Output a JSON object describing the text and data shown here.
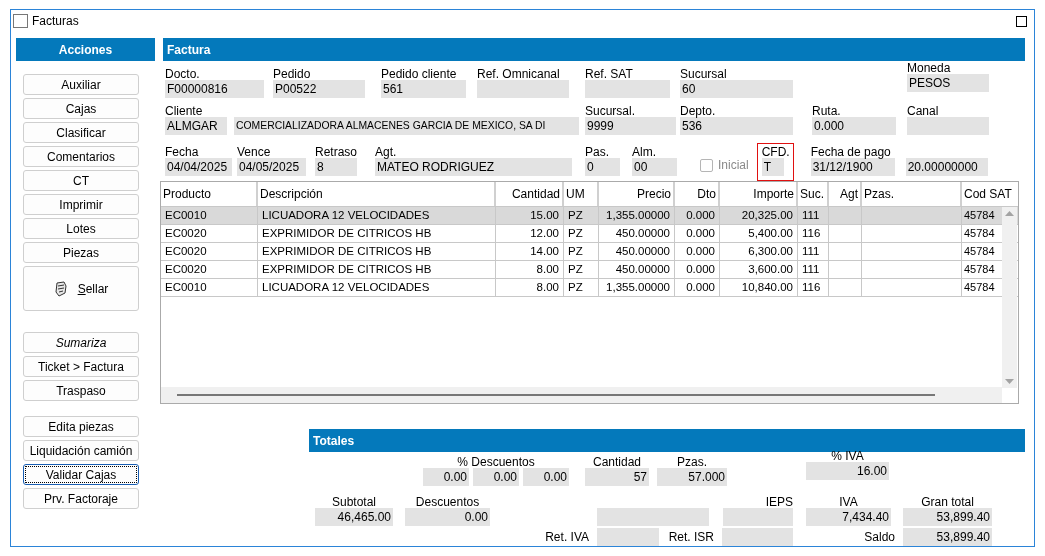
{
  "window": {
    "title": "Facturas"
  },
  "sidebar": {
    "title": "Acciones",
    "groups": [
      [
        {
          "label": "Auxiliar",
          "kind": "plain",
          "focused": false
        },
        {
          "label": "Cajas",
          "kind": "plain",
          "focused": false
        },
        {
          "label": "Clasificar",
          "kind": "plain",
          "focused": false
        },
        {
          "label": "Comentarios",
          "kind": "plain",
          "focused": false
        },
        {
          "label": "CT",
          "kind": "plain",
          "focused": false
        },
        {
          "label": "Imprimir",
          "kind": "plain",
          "focused": false
        },
        {
          "label": "Lotes",
          "kind": "plain",
          "focused": false
        },
        {
          "label": "Piezas",
          "kind": "plain",
          "focused": false
        },
        {
          "label": "Sellar",
          "kind": "icon",
          "mnemonic": true,
          "focused": false
        }
      ],
      [
        {
          "label": "Sumariza",
          "kind": "italic",
          "focused": false
        },
        {
          "label": "Ticket > Factura",
          "kind": "plain",
          "focused": false
        },
        {
          "label": "Traspaso",
          "kind": "plain",
          "focused": false
        }
      ],
      [
        {
          "label": "Edita piezas",
          "kind": "plain",
          "focused": false
        },
        {
          "label": "Liquidación camión",
          "kind": "plain",
          "focused": false
        },
        {
          "label": "Validar Cajas",
          "kind": "plain",
          "focused": true
        },
        {
          "label": "Prv. Factoraje",
          "kind": "plain",
          "focused": false
        }
      ]
    ]
  },
  "factura": {
    "title": "Factura",
    "fields": [
      {
        "kind": "field",
        "label": "Docto.",
        "value": "F00000816"
      },
      {
        "kind": "field",
        "label": "Pedido",
        "value": "P00522"
      },
      {
        "kind": "field",
        "label": "Pedido cliente",
        "value": "561"
      },
      {
        "kind": "field",
        "label": "Ref. Omnicanal"
      },
      {
        "kind": "field",
        "label": "Ref. SAT"
      },
      {
        "kind": "field",
        "label": "Sucursal",
        "value": "60"
      },
      {
        "kind": "field",
        "label": "Moneda",
        "value": "PESOS"
      },
      {
        "kind": "field",
        "label": "Cliente",
        "value": "ALMGAR"
      },
      {
        "kind": "field",
        "value": "COMERCIALIZADORA ALMACENES GARCIA DE MEXICO, SA DI"
      },
      {
        "kind": "field",
        "label": "Sucursal.",
        "value": "9999"
      },
      {
        "kind": "field",
        "label": "Depto.",
        "value": "536"
      },
      {
        "kind": "field",
        "label": "Ruta.",
        "value": "0.000"
      },
      {
        "kind": "field",
        "label": "Canal"
      },
      {
        "kind": "field",
        "label": "Fecha",
        "value": "04/04/2025"
      },
      {
        "kind": "field",
        "label": "Vence",
        "value": "04/05/2025"
      },
      {
        "kind": "field",
        "label": "Retraso",
        "value": "8"
      },
      {
        "kind": "field",
        "label": "Agt.",
        "value": "MATEO RODRIGUEZ"
      },
      {
        "kind": "field",
        "label": "Pas.",
        "value": "0"
      },
      {
        "kind": "field",
        "label": "Alm.",
        "value": "00"
      },
      {
        "kind": "checkbox",
        "label": "Inicial",
        "checked": false,
        "disabled": true
      },
      {
        "kind": "field",
        "label": "CFD.",
        "value": "T",
        "highlighted": true
      },
      {
        "kind": "field",
        "label": "Fecha de pago",
        "value": "31/12/1900"
      },
      {
        "kind": "field",
        "value": "20.00000000"
      }
    ]
  },
  "table": {
    "columns": [
      "Producto",
      "Descripción",
      "Cantidad",
      "UM",
      "Precio",
      "Dto",
      "Importe",
      "Suc.",
      "Agt",
      "Pzas.",
      "Cod SAT"
    ],
    "rows": [
      {
        "selected": true,
        "cells": [
          "EC0010",
          "LICUADORA 12 VELOCIDADES",
          "15.00",
          "PZ",
          "1,355.00000",
          "0.000",
          "20,325.00",
          "111",
          "",
          "",
          "45784"
        ]
      },
      {
        "selected": false,
        "cells": [
          "EC0020",
          "EXPRIMIDOR DE CITRICOS HB",
          "12.00",
          "PZ",
          "450.00000",
          "0.000",
          "5,400.00",
          "116",
          "",
          "",
          "45784"
        ]
      },
      {
        "selected": false,
        "cells": [
          "EC0020",
          "EXPRIMIDOR DE CITRICOS HB",
          "14.00",
          "PZ",
          "450.00000",
          "0.000",
          "6,300.00",
          "111",
          "",
          "",
          "45784"
        ]
      },
      {
        "selected": false,
        "cells": [
          "EC0020",
          "EXPRIMIDOR DE CITRICOS HB",
          "8.00",
          "PZ",
          "450.00000",
          "0.000",
          "3,600.00",
          "111",
          "",
          "",
          "45784"
        ]
      },
      {
        "selected": false,
        "cells": [
          "EC0010",
          "LICUADORA 12 VELOCIDADES",
          "8.00",
          "PZ",
          "1,355.00000",
          "0.000",
          "10,840.00",
          "116",
          "",
          "",
          "45784"
        ]
      }
    ]
  },
  "totales": {
    "title": "Totales",
    "fields": [
      {
        "kind": "group",
        "label": "% Descuentos",
        "values": [
          "0.00",
          "0.00",
          "0.00"
        ]
      },
      {
        "kind": "field",
        "label": "Cantidad",
        "value": "57"
      },
      {
        "kind": "field",
        "label": "Pzas.",
        "value": "57.000"
      },
      {
        "kind": "field",
        "label": "% IVA",
        "value": "16.00"
      },
      {
        "kind": "field",
        "label": "Subtotal",
        "value": "46,465.00"
      },
      {
        "kind": "field",
        "label": "Descuentos",
        "value": "0.00"
      },
      {
        "kind": "field"
      },
      {
        "kind": "field",
        "label": "IEPS"
      },
      {
        "kind": "field",
        "label": "IVA",
        "value": "7,434.40"
      },
      {
        "kind": "field",
        "label": "Gran total",
        "value": "53,899.40"
      },
      {
        "kind": "inline",
        "label": "Ret. IVA"
      },
      {
        "kind": "inline",
        "label": "Ret. ISR"
      },
      {
        "kind": "inline",
        "label": "Saldo",
        "value": "53,899.40"
      }
    ]
  }
}
